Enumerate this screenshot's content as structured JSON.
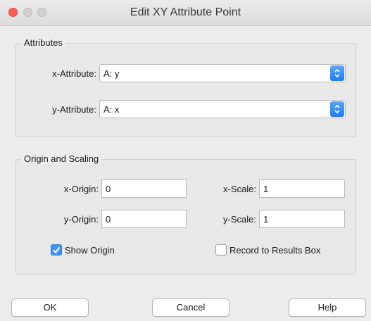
{
  "window": {
    "title": "Edit XY Attribute Point"
  },
  "attributes": {
    "group_label": "Attributes",
    "x_label": "x-Attribute:",
    "x_value": "A: y",
    "y_label": "y-Attribute:",
    "y_value": "A: x"
  },
  "origin_scaling": {
    "group_label": "Origin and Scaling",
    "x_origin_label": "x-Origin:",
    "x_origin_value": "0",
    "y_origin_label": "y-Origin:",
    "y_origin_value": "0",
    "x_scale_label": "x-Scale:",
    "x_scale_value": "1",
    "y_scale_label": "y-Scale:",
    "y_scale_value": "1",
    "show_origin_label": "Show Origin",
    "show_origin_checked": true,
    "record_label": "Record to Results Box",
    "record_checked": false
  },
  "buttons": {
    "ok": "OK",
    "cancel": "Cancel",
    "help": "Help"
  },
  "colors": {
    "accent": "#3f93f4",
    "close": "#fc5f57"
  }
}
